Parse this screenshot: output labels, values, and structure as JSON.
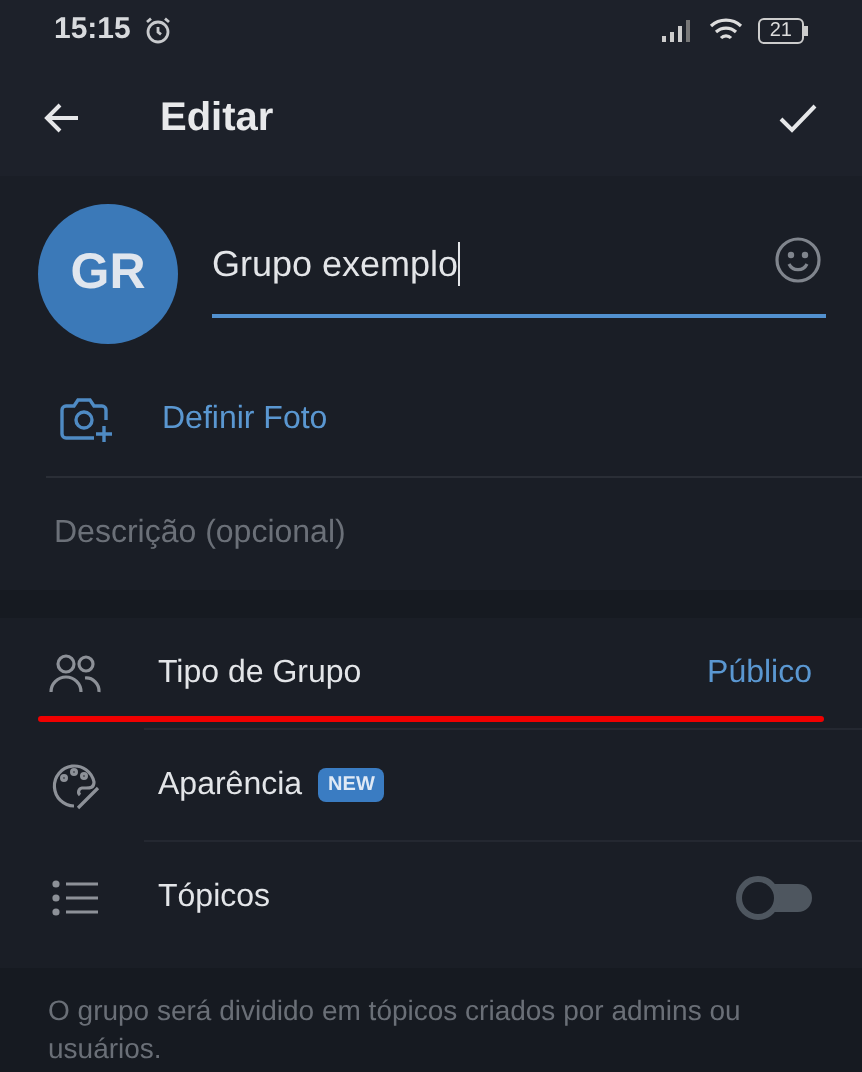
{
  "status_bar": {
    "time": "15:15",
    "battery": "21"
  },
  "header": {
    "title": "Editar"
  },
  "profile": {
    "initials": "GR",
    "name": "Grupo exemplo",
    "set_photo": "Definir Foto",
    "description_placeholder": "Descrição (opcional)"
  },
  "settings": [
    {
      "kind": "value",
      "label": "Tipo de Grupo",
      "value": "Público"
    },
    {
      "kind": "badge",
      "label": "Aparência",
      "badge": "NEW"
    },
    {
      "kind": "toggle",
      "label": "Tópicos",
      "on": false
    }
  ],
  "footer_note": "O grupo será dividido em tópicos criados por admins ou usuários."
}
